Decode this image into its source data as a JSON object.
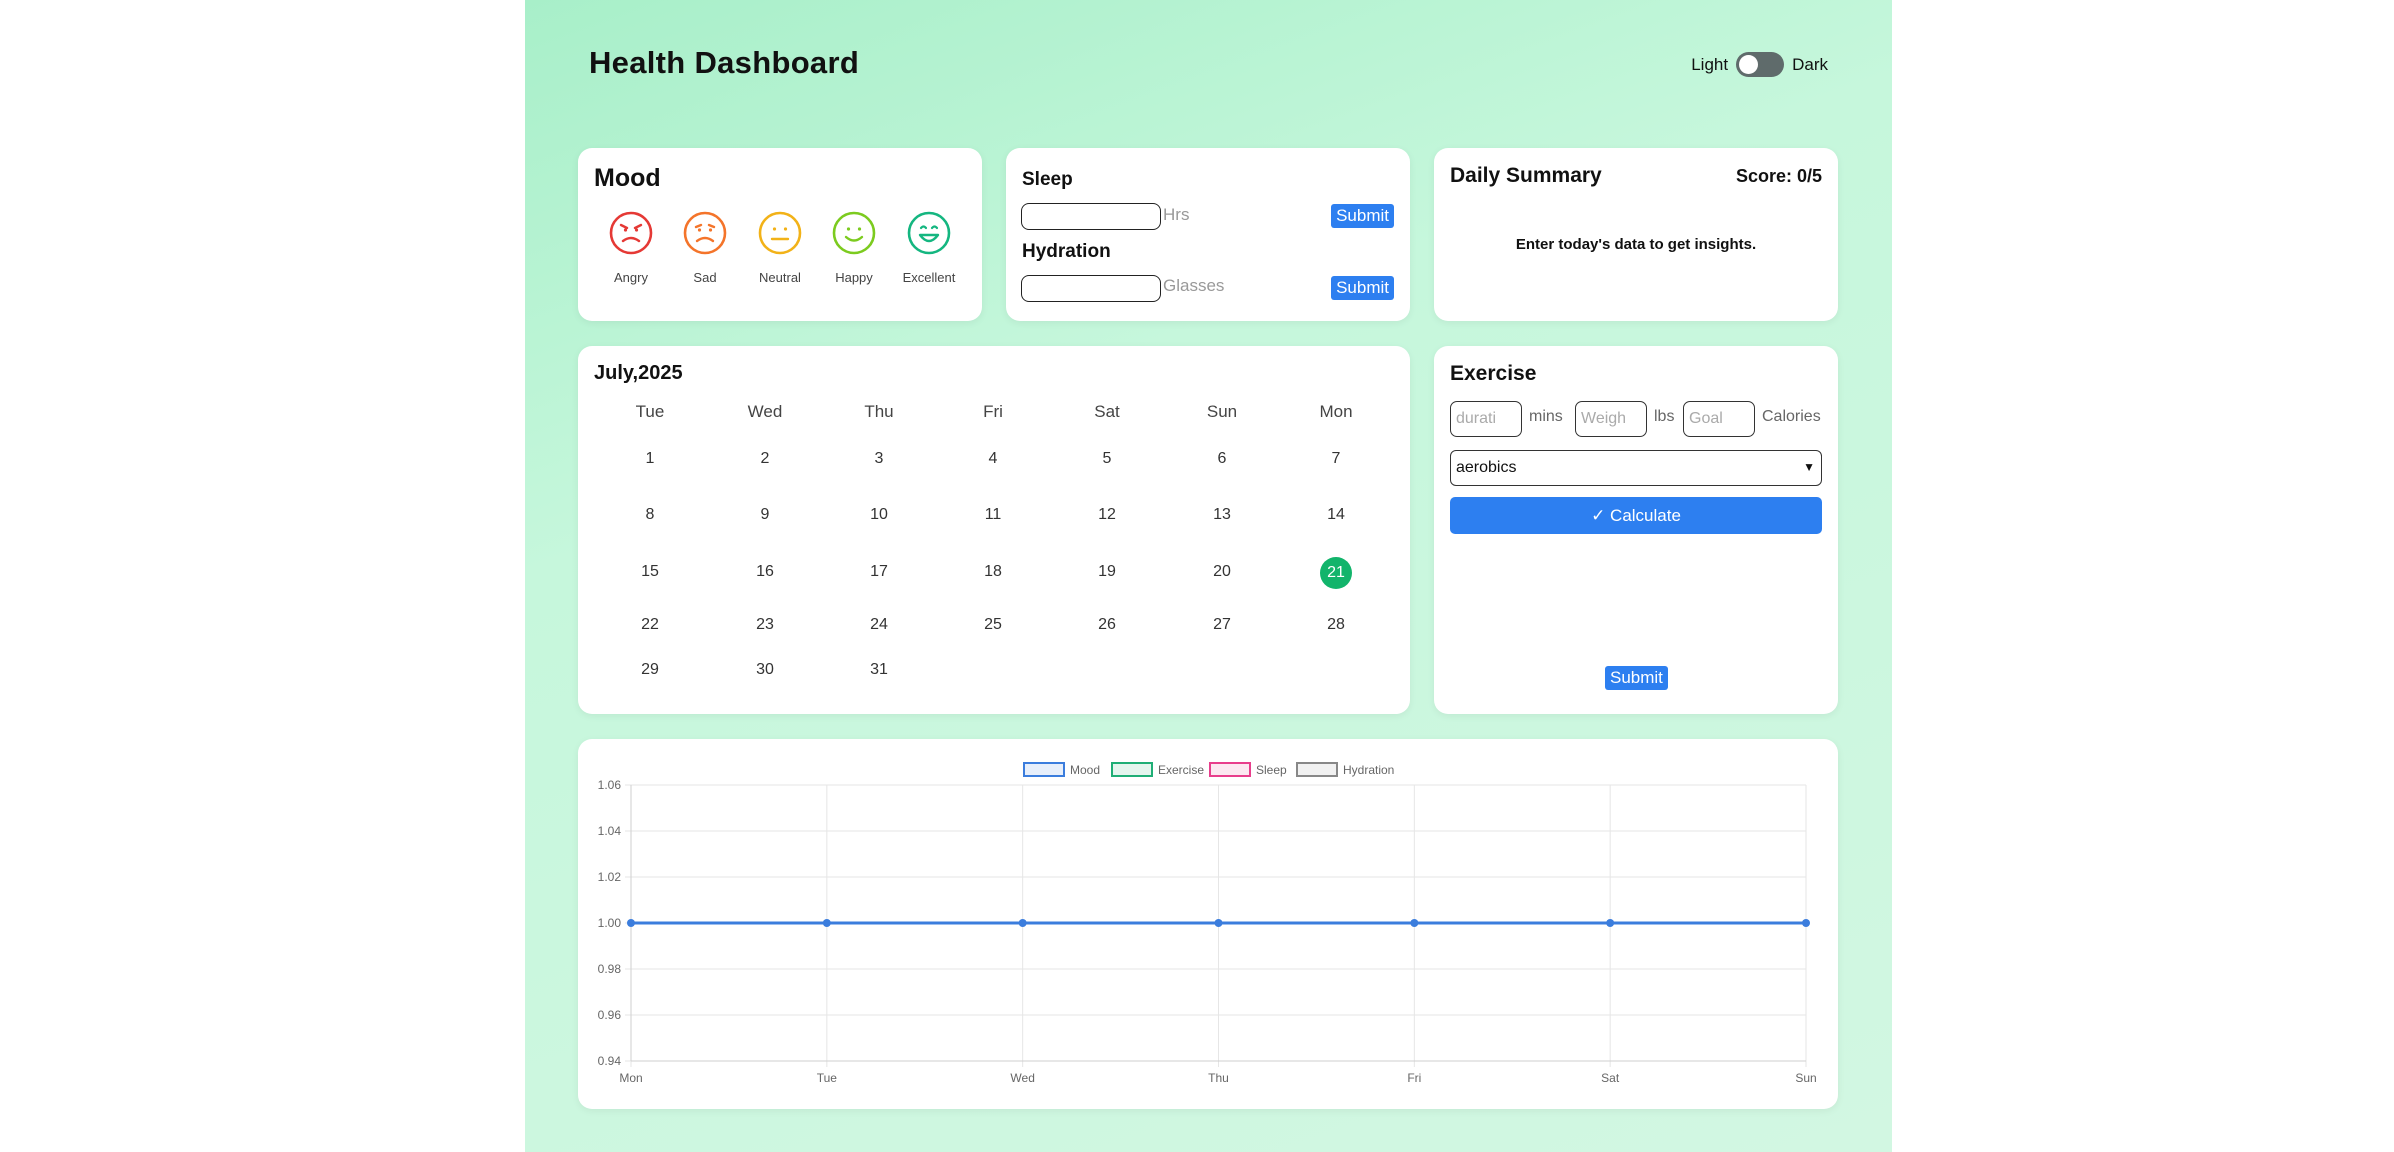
{
  "header": {
    "title": "Health Dashboard",
    "light_label": "Light",
    "dark_label": "Dark"
  },
  "mood": {
    "title": "Mood",
    "faces": [
      {
        "label": "Angry",
        "color": "#e53935",
        "icon": "angry-face-icon"
      },
      {
        "label": "Sad",
        "color": "#f4742a",
        "icon": "sad-face-icon"
      },
      {
        "label": "Neutral",
        "color": "#f2b218",
        "icon": "neutral-face-icon"
      },
      {
        "label": "Happy",
        "color": "#7ccb1f",
        "icon": "happy-face-icon"
      },
      {
        "label": "Excellent",
        "color": "#14b680",
        "icon": "excellent-face-icon"
      }
    ]
  },
  "sleep": {
    "title": "Sleep",
    "unit": "Hrs",
    "submit": "Submit",
    "value": ""
  },
  "hydration": {
    "title": "Hydration",
    "unit": "Glasses",
    "submit": "Submit",
    "value": ""
  },
  "summary": {
    "title": "Daily Summary",
    "score": "Score: 0/5",
    "hint": "Enter today's data to get insights."
  },
  "calendar": {
    "title": "July,2025",
    "weekdays": [
      "Tue",
      "Wed",
      "Thu",
      "Fri",
      "Sat",
      "Sun",
      "Mon"
    ],
    "days": [
      "1",
      "2",
      "3",
      "4",
      "5",
      "6",
      "7",
      "8",
      "9",
      "10",
      "11",
      "12",
      "13",
      "14",
      "15",
      "16",
      "17",
      "18",
      "19",
      "20",
      "21",
      "22",
      "23",
      "24",
      "25",
      "26",
      "27",
      "28",
      "29",
      "30",
      "31"
    ],
    "today": "21",
    "today_color": "#12b46b"
  },
  "exercise": {
    "title": "Exercise",
    "duration_placeholder": "durati",
    "duration_unit": "mins",
    "weight_placeholder": "Weigh",
    "weight_unit": "lbs",
    "goal_placeholder": "Goal",
    "goal_unit": "Calories",
    "activity_selected": "aerobics",
    "calculate_label": "✓ Calculate",
    "submit": "Submit"
  },
  "colors": {
    "accent": "#2d7ff0"
  },
  "chart_data": {
    "type": "line",
    "categories": [
      "Mon",
      "Tue",
      "Wed",
      "Thu",
      "Fri",
      "Sat",
      "Sun"
    ],
    "series": [
      {
        "name": "Mood",
        "values": [
          1,
          1,
          1,
          1,
          1,
          1,
          1
        ],
        "color": "#3b7ddd"
      },
      {
        "name": "Exercise",
        "values": [],
        "color": "#1fae76"
      },
      {
        "name": "Sleep",
        "values": [],
        "color": "#e83e8c"
      },
      {
        "name": "Hydration",
        "values": [],
        "color": "#888888"
      }
    ],
    "yticks": [
      "1.06",
      "1.04",
      "1.02",
      "1.00",
      "0.98",
      "0.96",
      "0.94"
    ],
    "ylim": [
      0.94,
      1.06
    ],
    "grid": true,
    "legend": "top-center"
  }
}
